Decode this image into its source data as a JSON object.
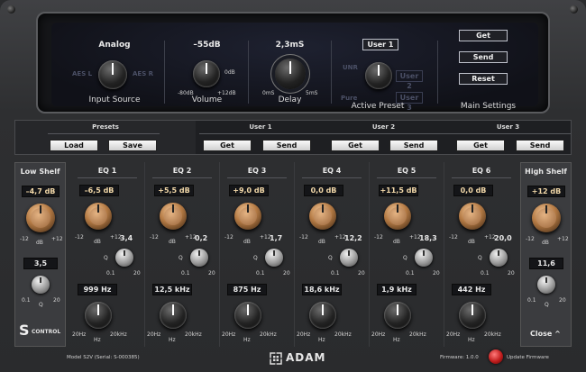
{
  "display": {
    "input_source": {
      "value": "Analog",
      "left": "AES L",
      "right": "AES R",
      "caption": "Input Source"
    },
    "volume": {
      "value": "–55dB",
      "min": "-80dB",
      "max": "+12dB",
      "top": "0dB",
      "caption": "Volume"
    },
    "delay": {
      "value": "2,3mS",
      "min": "0mS",
      "max": "5mS",
      "caption": "Delay"
    },
    "active_preset": {
      "value": "User 1",
      "opt_top": "UNR",
      "opt_mid": "User 2",
      "opt_left": "Pure",
      "opt_bottom": "User 3",
      "caption": "Active Preset"
    },
    "main_settings": {
      "get": "Get",
      "send": "Send",
      "reset": "Reset",
      "caption": "Main Settings"
    }
  },
  "presets": {
    "title": "Presets",
    "load": "Load",
    "save": "Save",
    "users": [
      {
        "title": "User 1",
        "get": "Get",
        "send": "Send"
      },
      {
        "title": "User 2",
        "get": "Get",
        "send": "Send"
      },
      {
        "title": "User 3",
        "get": "Get",
        "send": "Send"
      }
    ]
  },
  "low_shelf": {
    "title": "Low Shelf",
    "gain": "–4,7 dB",
    "min": "-12",
    "unit": "dB",
    "max": "+12",
    "q": "3,5",
    "qmin": "0.1",
    "qlabel": "Q",
    "qmax": "20"
  },
  "high_shelf": {
    "title": "High Shelf",
    "gain": "+12 dB",
    "min": "-12",
    "unit": "dB",
    "max": "+12",
    "q": "11,6",
    "qmin": "0.1",
    "qlabel": "Q",
    "qmax": "20"
  },
  "eq": [
    {
      "title": "EQ 1",
      "gain": "–6,5 dB",
      "q": "3,4",
      "freq": "999 Hz"
    },
    {
      "title": "EQ 2",
      "gain": "+5,5 dB",
      "q": "0,2",
      "freq": "12,5 kHz"
    },
    {
      "title": "EQ 3",
      "gain": "+9,0 dB",
      "q": "1,7",
      "freq": "875 Hz"
    },
    {
      "title": "EQ 4",
      "gain": "0,0 dB",
      "q": "12,2",
      "freq": "18,6 kHz"
    },
    {
      "title": "EQ 5",
      "gain": "+11,5 dB",
      "q": "18,3",
      "freq": "1,9 kHz"
    },
    {
      "title": "EQ 6",
      "gain": "0,0 dB",
      "q": "20,0",
      "freq": "442 Hz"
    }
  ],
  "eq_labels": {
    "gmin": "-12",
    "gunit": "dB",
    "gmax": "+12",
    "qlabel": "Q",
    "qmin": "0.1",
    "qmax": "20",
    "fmin": "20Hz",
    "funit": "Hz",
    "fmax": "20kHz"
  },
  "footer": {
    "logo_s": "S",
    "logo_control": "CONTROL",
    "model": "Model S2V (Serial: S-000385)",
    "brand": "ADAM",
    "firmware": "Firmware: 1.0.0",
    "update": "Update Firmware",
    "close": "Close"
  }
}
